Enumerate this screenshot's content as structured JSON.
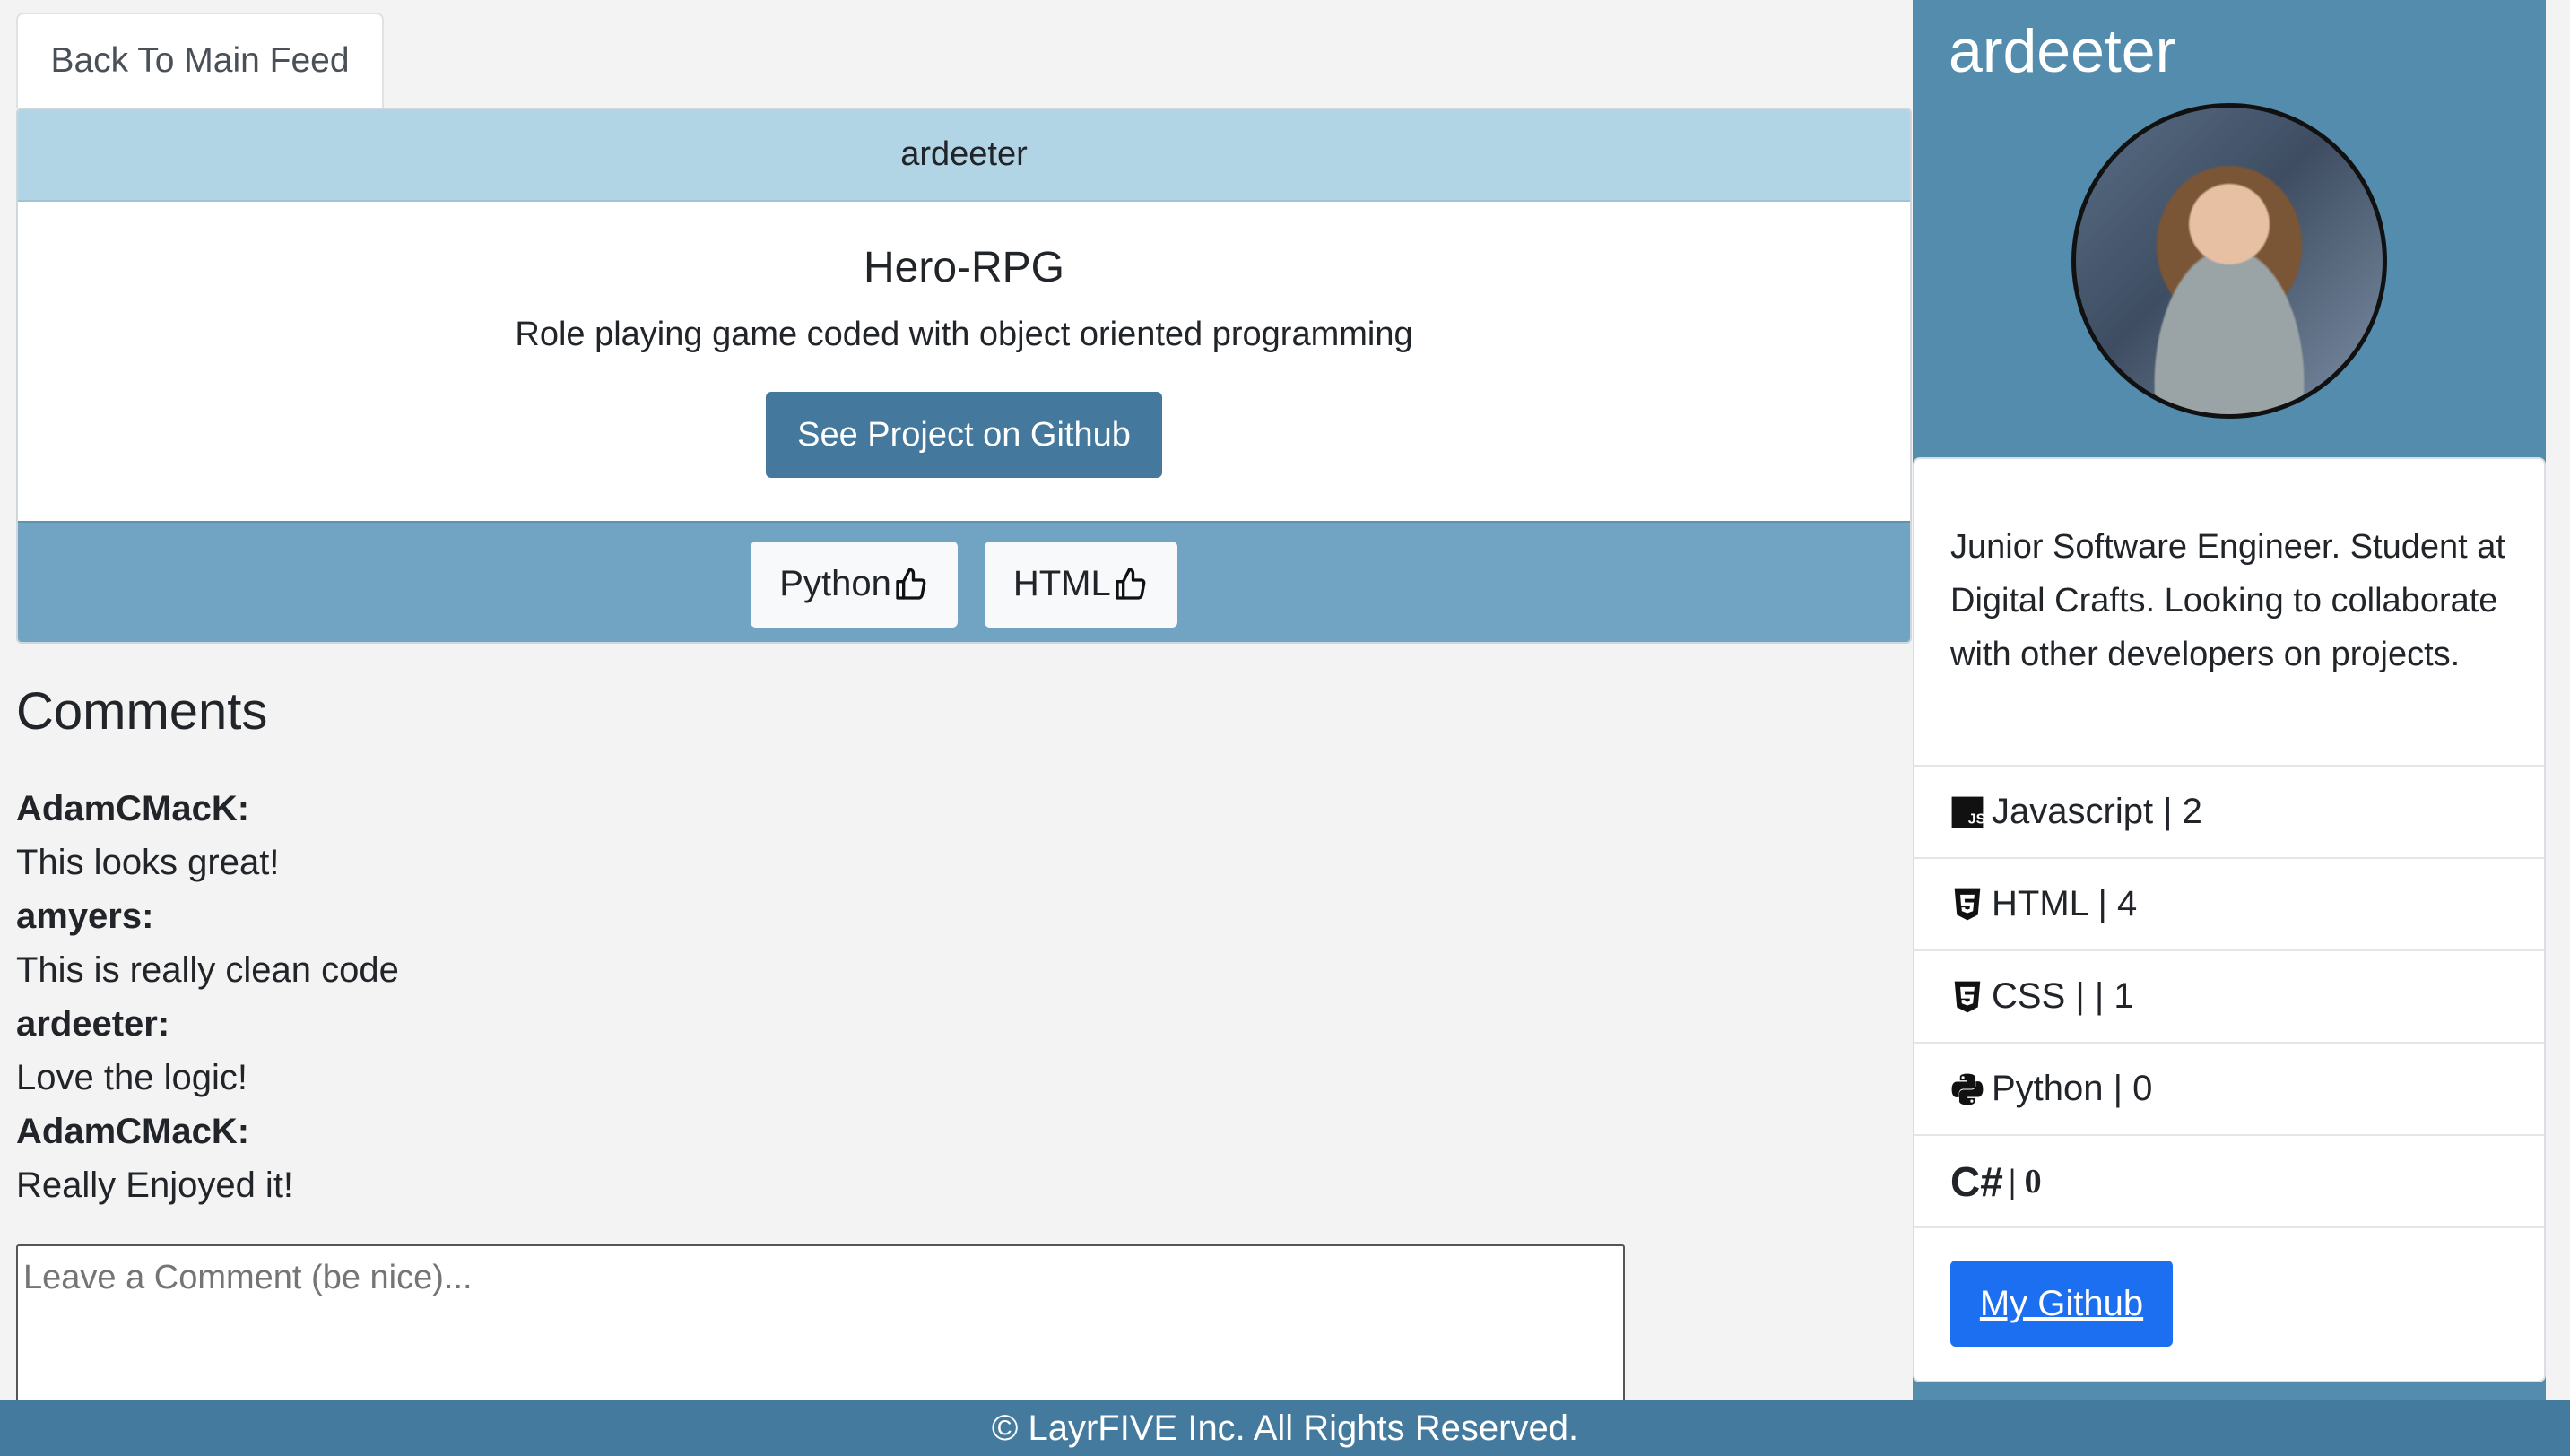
{
  "tab": {
    "label": "Back To Main Feed"
  },
  "project": {
    "author": "ardeeter",
    "title": "Hero-RPG",
    "description": "Role playing game coded with object oriented programming",
    "github_button": "See Project on Github",
    "tags": [
      {
        "label": "Python",
        "icon": "thumbs-up-icon"
      },
      {
        "label": "HTML",
        "icon": "thumbs-up-icon"
      }
    ]
  },
  "comments": {
    "heading": "Comments",
    "items": [
      {
        "author": "AdamCMacK:",
        "text": "This looks great!"
      },
      {
        "author": "amyers:",
        "text": "This is really clean code"
      },
      {
        "author": "ardeeter:",
        "text": "Love the logic!"
      },
      {
        "author": "AdamCMacK:",
        "text": "Really Enjoyed it!"
      }
    ],
    "input_placeholder": "Leave a Comment (be nice)..."
  },
  "sidebar": {
    "username": "ardeeter",
    "bio": "Junior Software Engineer. Student at Digital Crafts. Looking to collaborate with other developers on projects.",
    "skills": [
      {
        "icon": "javascript-icon",
        "label": "Javascript | 2"
      },
      {
        "icon": "html5-icon",
        "label": "HTML | 4"
      },
      {
        "icon": "css3-icon",
        "label": "CSS | | 1"
      },
      {
        "icon": "python-icon",
        "label": "Python | 0"
      },
      {
        "icon": "csharp-icon",
        "glyph": "C#",
        "label": "| 0"
      }
    ],
    "github_button": "My Github"
  },
  "footer": {
    "text": "© LayrFIVE Inc. All Rights Reserved."
  },
  "colors": {
    "header_band": "#b1d5e5",
    "tag_band": "#70a4c2",
    "primary_button": "#44799d",
    "sidebar": "#548cad",
    "github_link_button": "#1d6ff2",
    "footer": "#447a9d"
  }
}
